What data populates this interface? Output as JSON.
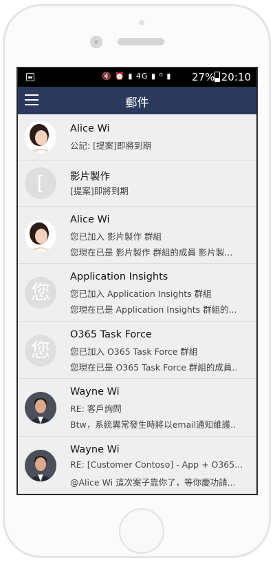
{
  "status_bar": {
    "icons": "🔇 ⏰ ▮ 4G ▮ ᴳ ▮",
    "battery_percent": "27%",
    "time": "20:10"
  },
  "app_bar": {
    "title": "郵件"
  },
  "messages": [
    {
      "name": "Alice Wi",
      "line1": "公記: [提案]即將到期",
      "line2": ""
    },
    {
      "name": "影片製作",
      "avatar_letter": "[",
      "line1": "[提案]即將到期",
      "line2": ""
    },
    {
      "name": "Alice Wi",
      "line1": "您已加入 影片製作 群組",
      "line2": "您現在已是 影片製作 群組的成員   影片製..."
    },
    {
      "name": "Application Insights",
      "avatar_letter": "您",
      "line1": "您已加入 Application Insights 群組",
      "line2": "您現在已是 Application Insights 群組的..."
    },
    {
      "name": "O365 Task Force",
      "avatar_letter": "您",
      "line1": "您已加入 O365 Task Force 群組",
      "line2": "您現在已是 O365 Task Force 群組的成員.."
    },
    {
      "name": "Wayne Wi",
      "line1": "RE: 客戶詢問",
      "line2": "Btw，系統異常發生時將以email通知維護.."
    },
    {
      "name": "Wayne Wi",
      "line1": "RE: [Customer Contoso] - App + O365...",
      "line2": "@Alice Wi  這次案子靠你了，等你慶功請..."
    }
  ],
  "colors": {
    "app_bar": "#2b3a5c",
    "list_bg": "#efefef",
    "avatar_placeholder": "#dedede"
  }
}
